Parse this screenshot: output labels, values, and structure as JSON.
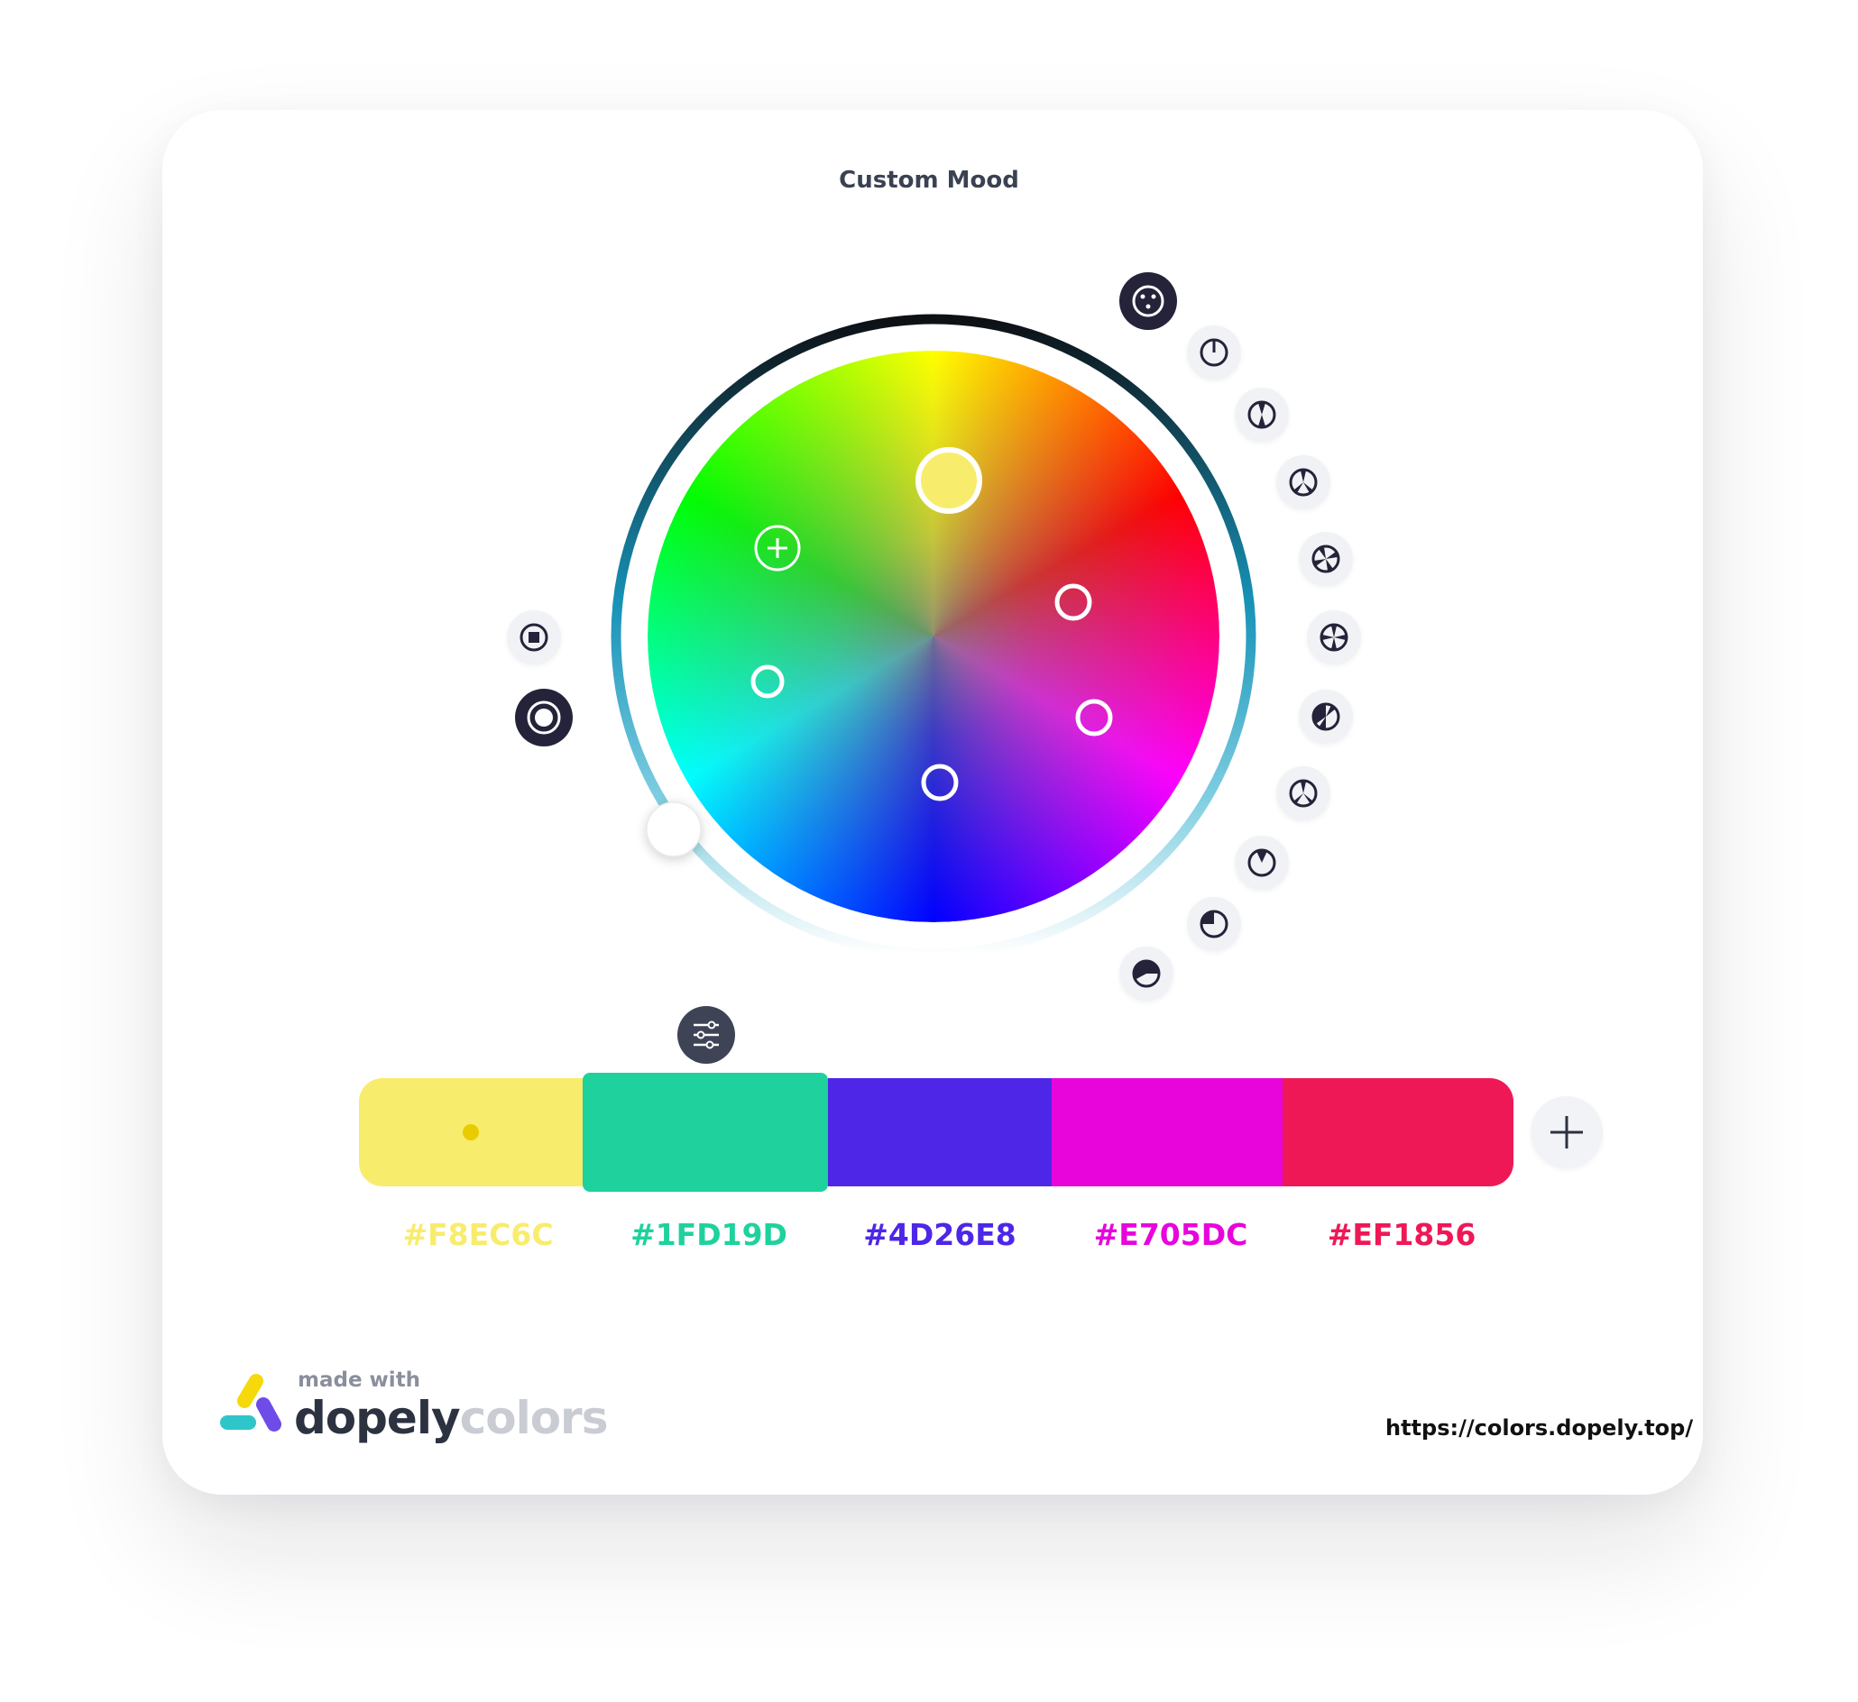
{
  "title": "Custom Mood",
  "palette": [
    {
      "hex": "#F8EC6C",
      "color": "#F8EC6C"
    },
    {
      "hex": "#1FD19D",
      "color": "#1FD19D"
    },
    {
      "hex": "#4D26E8",
      "color": "#4D26E8"
    },
    {
      "hex": "#E705DC",
      "color": "#E705DC"
    },
    {
      "hex": "#EF1856",
      "color": "#EF1856"
    }
  ],
  "footer": {
    "made_with": "made with",
    "brand_main": "dopely",
    "brand_accent": "colors",
    "url": "https://colors.dopely.top/"
  },
  "icons": {
    "add": "plus-icon",
    "adjust": "sliders-icon",
    "harmony": [
      "random-harmony-icon",
      "mono-icon",
      "analogous-icon",
      "triad-icon",
      "tetrad-icon",
      "square-icon",
      "split-icon",
      "three-icon",
      "complement-icon",
      "shade-icon",
      "tone-icon"
    ],
    "modes": [
      "square-mode-icon",
      "circle-mode-icon"
    ]
  }
}
